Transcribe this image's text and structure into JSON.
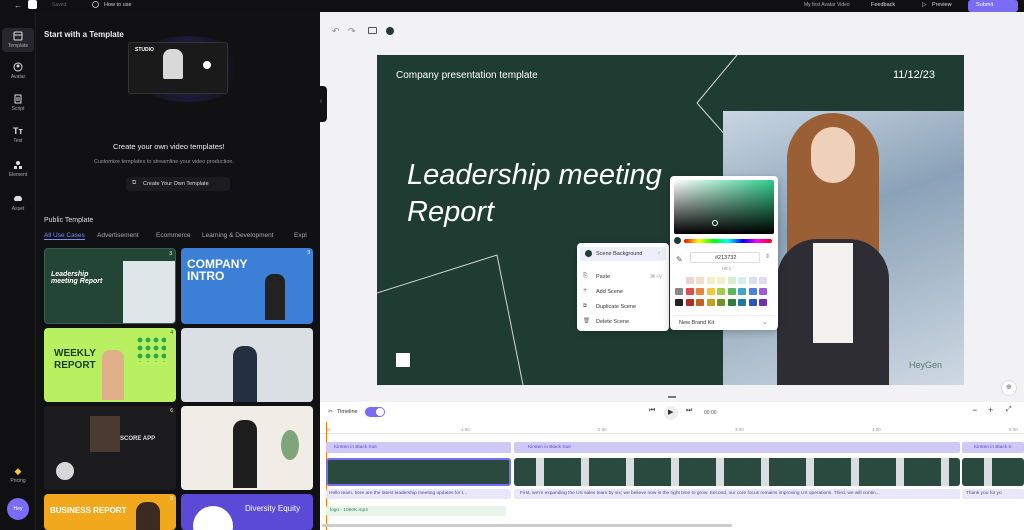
{
  "topbar": {
    "saved": "Saved",
    "how_to_use": "How to use",
    "video_name": "My first Avatar Video",
    "feedback": "Feedback",
    "preview": "Preview",
    "submit": "Submit"
  },
  "rail": [
    {
      "label": "Template",
      "icon": "template-icon"
    },
    {
      "label": "Avatar",
      "icon": "avatar-icon"
    },
    {
      "label": "Script",
      "icon": "script-icon"
    },
    {
      "label": "Text",
      "icon": "text-icon"
    },
    {
      "label": "Element",
      "icon": "element-icon"
    },
    {
      "label": "Asset",
      "icon": "asset-icon"
    }
  ],
  "rail_pricing": "Pricing",
  "rail_avatar": "Hey",
  "left": {
    "heading": "Start with a Template",
    "promo_tag": "STUDIO",
    "create_title": "Create your own video templates!",
    "create_sub": "Customize templates to streamline your video production.",
    "create_btn": "Create Your Own Template",
    "public_title": "Public Template",
    "tabs": [
      "All Use Cases",
      "Advertisement",
      "Ecommerce",
      "Learning & Development",
      "Expl"
    ],
    "thumbs": [
      {
        "title": "Leadership meeting Report",
        "count": "3"
      },
      {
        "title": "COMPANY INTRO",
        "count": "3"
      },
      {
        "title": "WEEKLY REPORT",
        "count": "4"
      },
      {
        "title": "",
        "count": ""
      },
      {
        "title": "SCORE APP",
        "count": "6"
      },
      {
        "title": "",
        "count": ""
      },
      {
        "title": "BUSINESS REPORT",
        "count": "8"
      },
      {
        "title": "Diversity Equity",
        "count": ""
      }
    ]
  },
  "toolbar": {
    "undo": "undo",
    "redo": "redo"
  },
  "slide": {
    "header_left": "Company presentation template",
    "header_right": "11/12/23",
    "title": "Leadership meeting Report",
    "watermark": "HeyGen"
  },
  "context_menu": {
    "items": [
      "Scene Background",
      "Paste",
      "Add Scene",
      "Duplicate Scene",
      "Delete Scene"
    ],
    "shortcut": "⌘+V"
  },
  "color_picker": {
    "hex": "#213732",
    "brand_kit": "New Brand Kit",
    "mode": "HEX",
    "swatches": [
      "#f1d0d0",
      "#f3ddc8",
      "#f7edc4",
      "#eef2c6",
      "#d6f0cf",
      "#d3edf0",
      "#d6dff5",
      "#e5d8f5",
      "#888888",
      "#e24b4b",
      "#e9843c",
      "#f0c840",
      "#a8c94a",
      "#5cb85c",
      "#3ca7c9",
      "#4d7ee0",
      "#9f5ad8",
      "#222222",
      "#b02a2a",
      "#c0631f",
      "#c4a21d",
      "#6f9428",
      "#2e7d3a",
      "#1e7a96",
      "#2b56b8",
      "#6f33a8"
    ]
  },
  "timeline": {
    "label": "Timeline",
    "time": "00:00",
    "ticks": [
      "0s",
      "1:00",
      "2:00",
      "3:00",
      "4:00",
      "5:00"
    ],
    "scene_labels": [
      "Kirsten in Black Suit",
      "Kirsten in Black Suit",
      "Kirsten in Black S"
    ],
    "scripts": [
      "Hello team, here are the latest leadership meeting updates for t...",
      "First, we're expanding the US sales team by six; we believe now is the right time to grow. Second, our core focus remains improving US operations. Third, we will contin...",
      "Thank you for yo"
    ],
    "music": "logo - 1080K.mp4"
  },
  "colors": {
    "accent": "#7b6cf6",
    "slide_bg": "#1f3c33"
  }
}
